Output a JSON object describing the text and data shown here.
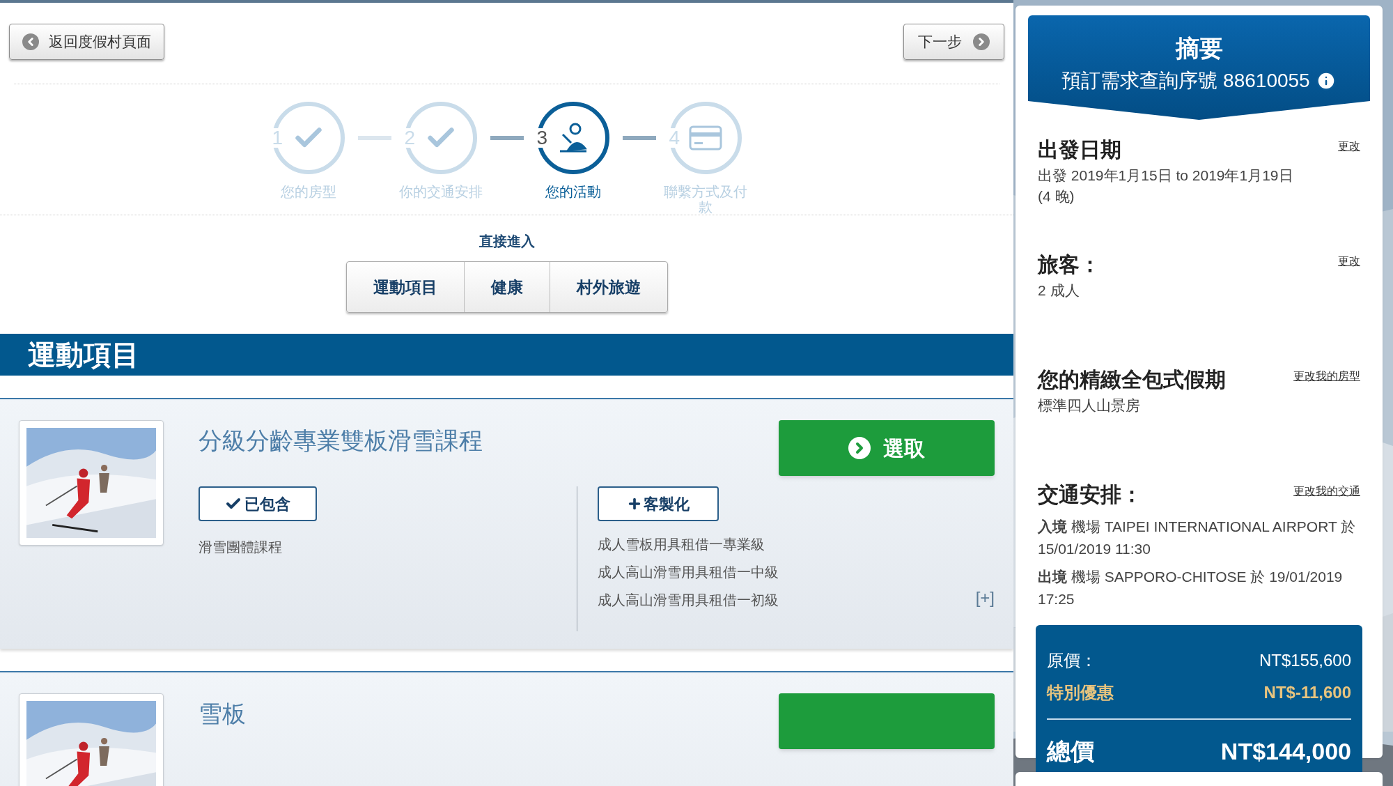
{
  "nav": {
    "back": "返回度假村頁面",
    "next": "下一步"
  },
  "steps": [
    {
      "number": "1",
      "label": "您的房型",
      "kind": "check",
      "selected": false
    },
    {
      "number": "2",
      "label": "你的交通安排",
      "kind": "check",
      "selected": false
    },
    {
      "number": "3",
      "label": "您的活動",
      "kind": "activity",
      "selected": true
    },
    {
      "number": "4",
      "label": "聯繫方式及付款",
      "kind": "payment",
      "selected": false
    }
  ],
  "jump": {
    "title": "直接進入",
    "buttons": [
      "運動項目",
      "健康",
      "村外旅遊"
    ]
  },
  "section": {
    "title": "運動項目"
  },
  "activities": [
    {
      "title": "分級分齡專業雙板滑雪課程",
      "select_button": "選取",
      "included_button": "已包含",
      "included": [
        "滑雪團體課程"
      ],
      "custom_button": "客製化",
      "custom": [
        "成人雪板用具租借一專業級",
        "成人高山滑雪用具租借一中級",
        "成人高山滑雪用具租借一初級"
      ],
      "expand": "[+]"
    },
    {
      "title": "雪板"
    }
  ],
  "summary": {
    "title": "摘要",
    "reference": "預訂需求查詢序號 88610055",
    "sections": [
      {
        "heading": "出發日期",
        "link": "更改",
        "lines": [
          "出發 2019年1月15日 to 2019年1月19日",
          "(4 晚)"
        ]
      },
      {
        "heading": "旅客：",
        "link": "更改",
        "lines": [
          "2 成人"
        ]
      },
      {
        "heading": "您的精緻全包式假期",
        "link": "更改我的房型",
        "lines": [
          "標準四人山景房"
        ]
      },
      {
        "heading": "交通安排：",
        "link": "更改我的交通",
        "lines": [
          "**入境** 機場 TAIPEI INTERNATIONAL AIRPORT 於 15/01/2019 11:30",
          "**出境** 機場 SAPPORO-CHITOSE 於 19/01/2019 17:25"
        ]
      }
    ],
    "prices": [
      {
        "label": "原價：",
        "value": "NT$155,600",
        "kind": "normal"
      },
      {
        "label": "特別優惠",
        "value": "NT$-11,600",
        "kind": "discount"
      }
    ],
    "total": {
      "label": "總價",
      "value": "NT$144,000"
    }
  }
}
